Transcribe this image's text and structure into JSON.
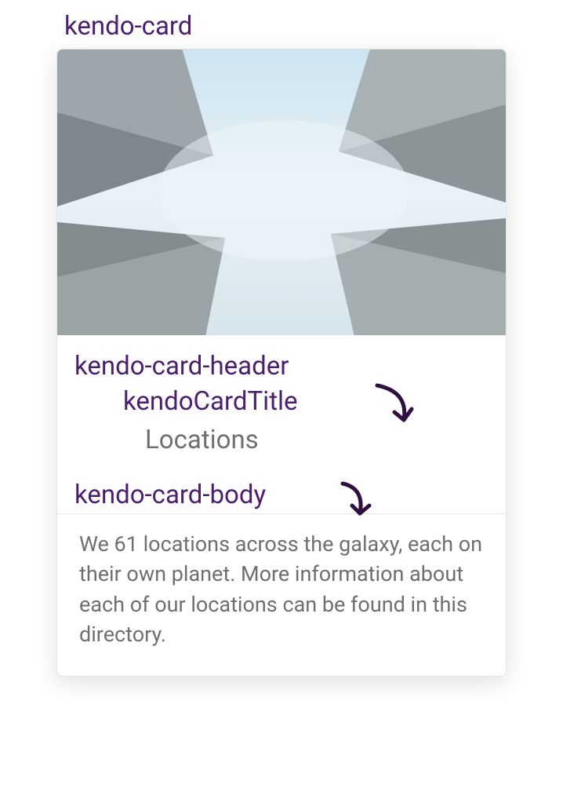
{
  "labels": {
    "card": "kendo-card",
    "header": "kendo-card-header",
    "title_component": "kendoCardTitle",
    "body": "kendo-card-body"
  },
  "card": {
    "title": "Locations",
    "body_text": "We 61 locations across the galaxy, each on their own planet. More information about each of our locations can be found in this directory."
  }
}
